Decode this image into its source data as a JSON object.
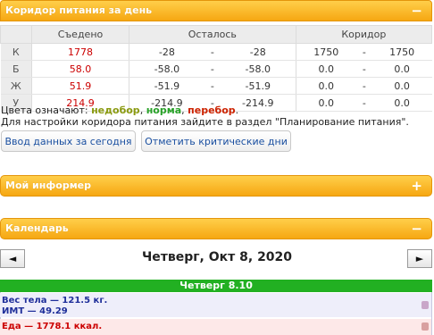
{
  "corridor_panel": {
    "title": "Коридор питания за день",
    "toggle": "−",
    "headers": {
      "eaten": "Съедено",
      "left": "Осталось",
      "corridor": "Коридор"
    },
    "rows": [
      {
        "label": "К",
        "eaten": "1778",
        "left_from": "-28",
        "left_sep": "-",
        "left_to": "-28",
        "cor_from": "1750",
        "cor_sep": "-",
        "cor_to": "1750"
      },
      {
        "label": "Б",
        "eaten": "58.0",
        "left_from": "-58.0",
        "left_sep": "-",
        "left_to": "-58.0",
        "cor_from": "0.0",
        "cor_sep": "-",
        "cor_to": "0.0"
      },
      {
        "label": "Ж",
        "eaten": "51.9",
        "left_from": "-51.9",
        "left_sep": "-",
        "left_to": "-51.9",
        "cor_from": "0.0",
        "cor_sep": "-",
        "cor_to": "0.0"
      },
      {
        "label": "У",
        "eaten": "214.9",
        "left_from": "-214.9",
        "left_sep": "-",
        "left_to": "-214.9",
        "cor_from": "0.0",
        "cor_sep": "-",
        "cor_to": "0.0"
      }
    ],
    "legend": {
      "prefix": "Цвета означают: ",
      "under": "недобор",
      "comma1": ", ",
      "norm": "норма",
      "comma2": ", ",
      "over": "перебор",
      "end": "."
    },
    "note": "Для настройки коридора питания зайдите в раздел \"Планирование питания\".",
    "btn_today": "Ввод данных за сегодня",
    "btn_critical": "Отметить критические дни",
    "colors": {
      "under": "#8a9a10",
      "norm": "#27a127",
      "over": "#cc2200"
    }
  },
  "informer_panel": {
    "title": "Мой информер",
    "toggle": "+"
  },
  "calendar_panel": {
    "title": "Календарь",
    "toggle": "−",
    "prev": "◄",
    "next": "►",
    "date": "Четверг, Окт 8, 2020",
    "day_bar": "Четверг 8.10",
    "weight": "Вес тела — 121.5 кг.",
    "bmi": "ИМТ — 49.29",
    "food": "Еда — 1778.1 ккал."
  }
}
